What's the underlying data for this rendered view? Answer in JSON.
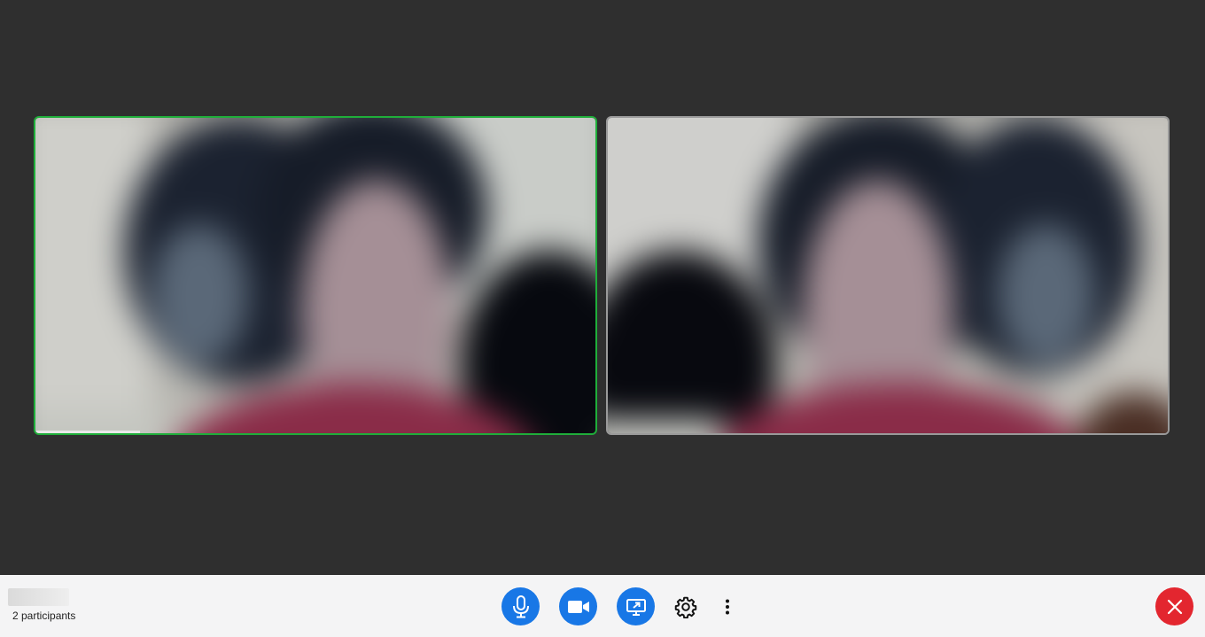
{
  "meeting": {
    "participant_count_label": "2 participants"
  },
  "controls": {
    "mic": "microphone-icon",
    "camera": "video-camera-icon",
    "share": "screen-share-icon",
    "settings": "gear-icon",
    "more": "more-vertical-icon",
    "leave": "close-icon"
  },
  "colors": {
    "stage_bg": "#2f2f2f",
    "toolbar_bg": "#f4f4f5",
    "active_speaker_border": "#1fae3a",
    "primary_button": "#1877e6",
    "leave_button": "#e3262f"
  }
}
